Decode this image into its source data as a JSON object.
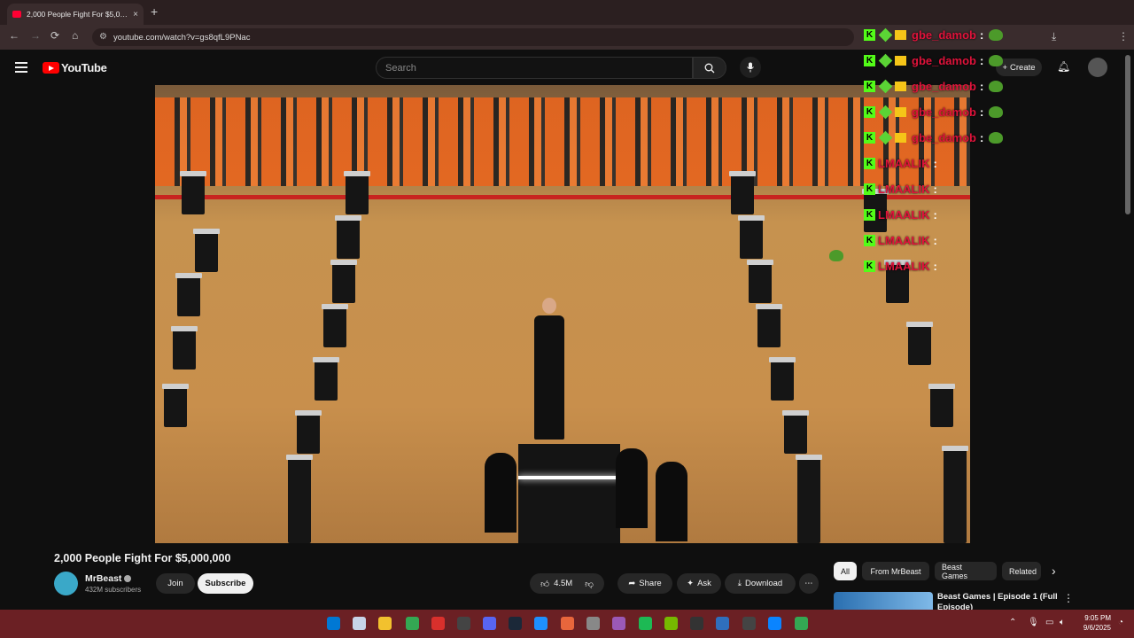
{
  "browser": {
    "tab_title": "2,000 People Fight For $5,0…",
    "tab_close": "×",
    "new_tab": "+",
    "url": "youtube.com/watch?v=gs8qfL9PNac"
  },
  "header": {
    "logo_text": "YouTube",
    "search_placeholder": "Search",
    "create_label": "Create"
  },
  "chat_overlay": {
    "rows": [
      {
        "user": "gbe_damob",
        "badges": [
          "kick",
          "diamond",
          "crown"
        ],
        "emote": "pepe"
      },
      {
        "user": "gbe_damob",
        "badges": [
          "kick",
          "diamond",
          "crown"
        ],
        "emote": "pepe"
      },
      {
        "user": "gbe_damob",
        "badges": [
          "kick",
          "diamond",
          "crown"
        ],
        "emote": "pepe"
      },
      {
        "user": "gbe_damob",
        "badges": [
          "kick",
          "diamond",
          "crown"
        ],
        "emote": "pepe"
      },
      {
        "user": "gbe_damob",
        "badges": [
          "kick",
          "diamond",
          "crown"
        ],
        "emote": "pepe"
      },
      {
        "user": "LMAALIK",
        "badges": [
          "kick"
        ]
      },
      {
        "user": "LMAALIK",
        "badges": [
          "kick"
        ]
      },
      {
        "user": "LMAALIK",
        "badges": [
          "kick"
        ]
      },
      {
        "user": "LMAALIK",
        "badges": [
          "kick"
        ]
      },
      {
        "user": "LMAALIK",
        "badges": [
          "kick"
        ]
      }
    ],
    "colon": ":",
    "kick_letter": "K"
  },
  "video": {
    "title": "2,000 People Fight For $5,000,000",
    "channel": "MrBeast",
    "subscribers": "432M subscribers",
    "join_label": "Join",
    "subscribe_label": "Subscribe",
    "likes": "4.5M",
    "share_label": "Share",
    "ask_label": "Ask",
    "download_label": "Download",
    "more_label": "⋯"
  },
  "related": {
    "chips": [
      "All",
      "From MrBeast",
      "Beast Games",
      "Related"
    ],
    "active_chip": "All",
    "next_arrow": "›",
    "first_item_title": "Beast Games | Episode 1 (Full Episode)"
  },
  "taskbar": {
    "time": "9:05 PM",
    "date": "9/6/2025",
    "colors": [
      "#0078d4",
      "#c7d4e8",
      "#f2c12e",
      "#34a853",
      "#d9302c",
      "#444444",
      "#5865f2",
      "#1b2838",
      "#1e90ff",
      "#e8663c",
      "#888888",
      "#9b59b6",
      "#1db954",
      "#76b900",
      "#333333",
      "#2f6fbd",
      "#444444",
      "#0a84ff",
      "#34a853"
    ]
  },
  "icons": {
    "back": "back-arrow-icon",
    "search": "search-icon",
    "mic": "mic-icon",
    "bell": "bell-icon"
  }
}
